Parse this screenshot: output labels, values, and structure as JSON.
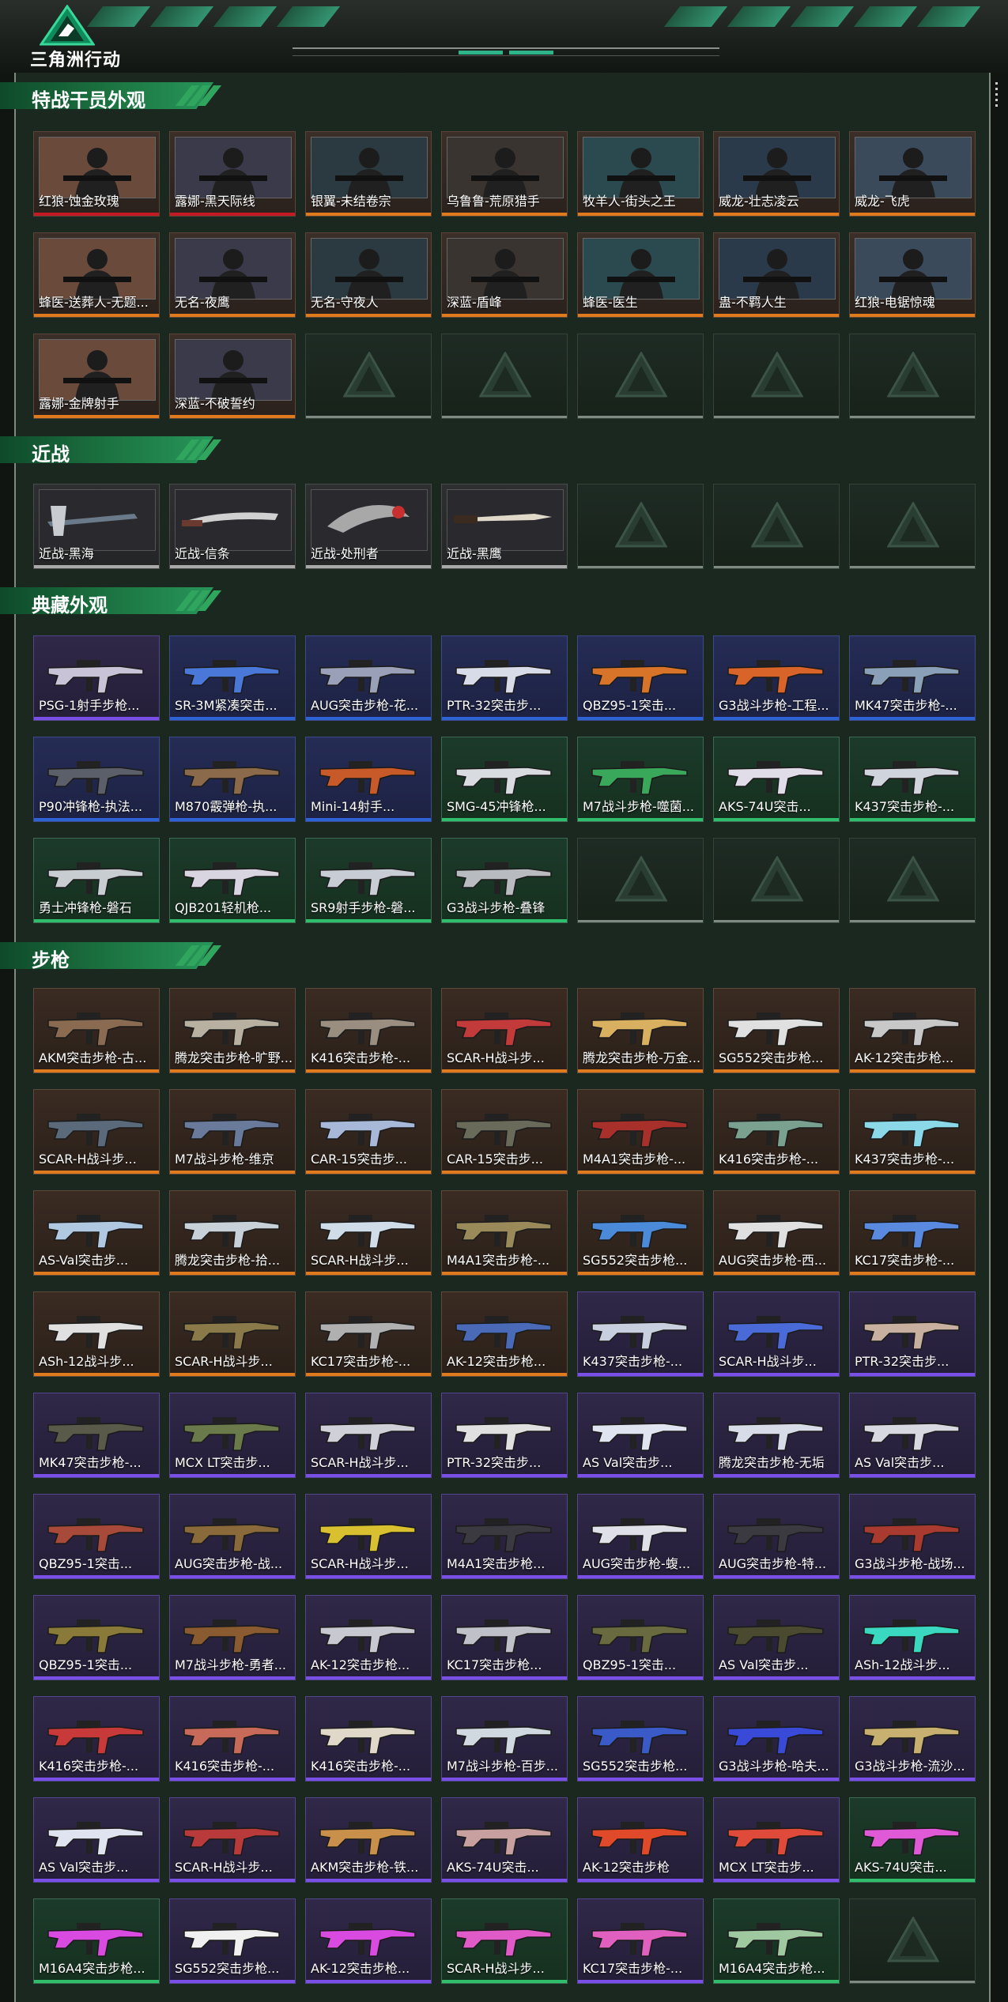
{
  "brand": {
    "name": "三角洲行动"
  },
  "sections": {
    "operators": "特战干员外观",
    "melee": "近战",
    "collection": "典藏外观",
    "rifles": "步枪"
  },
  "operators": [
    {
      "name": "红狼-蚀金玫瑰",
      "rarity": "red"
    },
    {
      "name": "露娜-黑天际线",
      "rarity": "red"
    },
    {
      "name": "银翼-未结卷宗",
      "rarity": "gold"
    },
    {
      "name": "乌鲁鲁-荒原猎手",
      "rarity": "gold"
    },
    {
      "name": "牧羊人-街头之王",
      "rarity": "gold"
    },
    {
      "name": "威龙-壮志凌云",
      "rarity": "gold"
    },
    {
      "name": "威龙-飞虎",
      "rarity": "gold"
    },
    {
      "name": "蜂医-送葬人-无题...",
      "rarity": "gold"
    },
    {
      "name": "无名-夜鹰",
      "rarity": "gold"
    },
    {
      "name": "无名-守夜人",
      "rarity": "gold"
    },
    {
      "name": "深蓝-盾峰",
      "rarity": "gold"
    },
    {
      "name": "蜂医-医生",
      "rarity": "gold"
    },
    {
      "name": "蛊-不羁人生",
      "rarity": "gold"
    },
    {
      "name": "红狼-电锯惊魂",
      "rarity": "gold"
    },
    {
      "name": "露娜-金牌射手",
      "rarity": "gold"
    },
    {
      "name": "深蓝-不破誓约",
      "rarity": "gold"
    }
  ],
  "melee": [
    {
      "name": "近战-黑海"
    },
    {
      "name": "近战-信条"
    },
    {
      "name": "近战-处刑者"
    },
    {
      "name": "近战-黑鹰"
    }
  ],
  "collection": [
    {
      "name": "PSG-1射手步枪...",
      "rarity": "pur",
      "color": "#c9c3d8"
    },
    {
      "name": "SR-3M紧凑突击...",
      "rarity": "blu",
      "color": "#4a78d8"
    },
    {
      "name": "AUG突击步枪-花...",
      "rarity": "blu",
      "color": "#9aa0b8"
    },
    {
      "name": "PTR-32突击步...",
      "rarity": "blu",
      "color": "#d8dce8"
    },
    {
      "name": "QBZ95-1突击...",
      "rarity": "blu",
      "color": "#d8742a"
    },
    {
      "name": "G3战斗步枪-工程...",
      "rarity": "blu",
      "color": "#d8642a"
    },
    {
      "name": "MK47突击步枪-...",
      "rarity": "blu",
      "color": "#8aa0b8"
    },
    {
      "name": "P90冲锋枪-执法...",
      "rarity": "blu",
      "color": "#5a5f6a"
    },
    {
      "name": "M870霰弹枪-执...",
      "rarity": "blu",
      "color": "#8a6a4a"
    },
    {
      "name": "Mini-14射手...",
      "rarity": "blu",
      "color": "#c85a2a"
    },
    {
      "name": "SMG-45冲锋枪...",
      "rarity": "grn",
      "color": "#d8dce0"
    },
    {
      "name": "M7战斗步枪-噬菌...",
      "rarity": "grn",
      "color": "#3aa85a"
    },
    {
      "name": "AKS-74U突击...",
      "rarity": "grn",
      "color": "#e0dce8"
    },
    {
      "name": "K437突击步枪-...",
      "rarity": "grn",
      "color": "#d0d4dc"
    },
    {
      "name": "勇士冲锋枪-磐石",
      "rarity": "grn",
      "color": "#c8cdd2"
    },
    {
      "name": "QJB201轻机枪...",
      "rarity": "grn",
      "color": "#d8d4e0"
    },
    {
      "name": "SR9射手步枪-磐...",
      "rarity": "grn",
      "color": "#c8ccd4"
    },
    {
      "name": "G3战斗步枪-叠锋",
      "rarity": "grn",
      "color": "#b8bcc0"
    }
  ],
  "rifles": [
    {
      "name": "AKM突击步枪-古...",
      "rarity": "org",
      "color": "#8a6a50"
    },
    {
      "name": "腾龙突击步枪-旷野...",
      "rarity": "org",
      "color": "#b8b0a0"
    },
    {
      "name": "K416突击步枪-...",
      "rarity": "org",
      "color": "#9a8e80"
    },
    {
      "name": "SCAR-H战斗步...",
      "rarity": "org",
      "color": "#c23a3a"
    },
    {
      "name": "腾龙突击步枪-万金...",
      "rarity": "org",
      "color": "#d8b060"
    },
    {
      "name": "SG552突击步枪...",
      "rarity": "org",
      "color": "#e0e0e0"
    },
    {
      "name": "AK-12突击步枪...",
      "rarity": "org",
      "color": "#c8c8c8"
    },
    {
      "name": "SCAR-H战斗步...",
      "rarity": "org",
      "color": "#5a6a7a"
    },
    {
      "name": "M7战斗步枪-维京",
      "rarity": "org",
      "color": "#6a7a9a"
    },
    {
      "name": "CAR-15突击步...",
      "rarity": "org",
      "color": "#a8b8d8"
    },
    {
      "name": "CAR-15突击步...",
      "rarity": "org",
      "color": "#6a6a5a"
    },
    {
      "name": "M4A1突击步枪-...",
      "rarity": "org",
      "color": "#a8302a"
    },
    {
      "name": "K416突击步枪-...",
      "rarity": "org",
      "color": "#7aa090"
    },
    {
      "name": "K437突击步枪-...",
      "rarity": "org",
      "color": "#8ad8e8"
    },
    {
      "name": "AS-Val突击步...",
      "rarity": "org",
      "color": "#b0c8e0"
    },
    {
      "name": "腾龙突击步枪-拾...",
      "rarity": "org",
      "color": "#c8d0d8"
    },
    {
      "name": "SCAR-H战斗步...",
      "rarity": "org",
      "color": "#d0dce8"
    },
    {
      "name": "M4A1突击步枪-...",
      "rarity": "org",
      "color": "#9a8a5a"
    },
    {
      "name": "SG552突击步枪...",
      "rarity": "org",
      "color": "#4a8ad8"
    },
    {
      "name": "AUG突击步枪-西...",
      "rarity": "org",
      "color": "#e0e0e0"
    },
    {
      "name": "KC17突击步枪-...",
      "rarity": "org",
      "color": "#5a8ae0"
    },
    {
      "name": "ASh-12战斗步...",
      "rarity": "org",
      "color": "#e0e0e0"
    },
    {
      "name": "SCAR-H战斗步...",
      "rarity": "org",
      "color": "#8a7a4a"
    },
    {
      "name": "KC17突击步枪-...",
      "rarity": "org",
      "color": "#b0b0b0"
    },
    {
      "name": "AK-12突击步枪...",
      "rarity": "org",
      "color": "#4a6ab8"
    },
    {
      "name": "K437突击步枪-...",
      "rarity": "pur",
      "color": "#c8d0e0"
    },
    {
      "name": "SCAR-H战斗步...",
      "rarity": "pur",
      "color": "#4a6ad8"
    },
    {
      "name": "PTR-32突击步...",
      "rarity": "pur",
      "color": "#c8b0a0"
    },
    {
      "name": "MK47突击步枪-...",
      "rarity": "pur",
      "color": "#5a5a4a"
    },
    {
      "name": "MCX LT突击步...",
      "rarity": "pur",
      "color": "#6a7a4a"
    },
    {
      "name": "SCAR-H战斗步...",
      "rarity": "pur",
      "color": "#d0d0d8"
    },
    {
      "name": "PTR-32突击步...",
      "rarity": "pur",
      "color": "#e0e0e0"
    },
    {
      "name": "AS Val突击步...",
      "rarity": "pur",
      "color": "#e0e4f0"
    },
    {
      "name": "腾龙突击步枪-无垢",
      "rarity": "pur",
      "color": "#d8dce8"
    },
    {
      "name": "AS Val突击步...",
      "rarity": "pur",
      "color": "#d8d8e0"
    },
    {
      "name": "QBZ95-1突击...",
      "rarity": "pur",
      "color": "#a84a3a"
    },
    {
      "name": "AUG突击步枪-战...",
      "rarity": "pur",
      "color": "#8a6a3a"
    },
    {
      "name": "SCAR-H战斗步...",
      "rarity": "pur",
      "color": "#d8c030"
    },
    {
      "name": "M4A1突击步枪...",
      "rarity": "pur",
      "color": "#3a3a40"
    },
    {
      "name": "AUG突击步枪-蝮...",
      "rarity": "pur",
      "color": "#e0e0e8"
    },
    {
      "name": "AUG突击步枪-特...",
      "rarity": "pur",
      "color": "#3a3a40"
    },
    {
      "name": "G3战斗步枪-战场...",
      "rarity": "pur",
      "color": "#a83a30"
    },
    {
      "name": "QBZ95-1突击...",
      "rarity": "pur",
      "color": "#8a7a3a"
    },
    {
      "name": "M7战斗步枪-勇者...",
      "rarity": "pur",
      "color": "#8a5a30"
    },
    {
      "name": "AK-12突击步枪...",
      "rarity": "pur",
      "color": "#c8c8d0"
    },
    {
      "name": "KC17突击步枪...",
      "rarity": "pur",
      "color": "#c0c0c8"
    },
    {
      "name": "QBZ95-1突击...",
      "rarity": "pur",
      "color": "#6a6a40"
    },
    {
      "name": "AS Val突击步...",
      "rarity": "pur",
      "color": "#4a4a30"
    },
    {
      "name": "ASh-12战斗步...",
      "rarity": "pur",
      "color": "#3ad8c0"
    },
    {
      "name": "K416突击步枪-...",
      "rarity": "pur",
      "color": "#c83a3a"
    },
    {
      "name": "K416突击步枪-...",
      "rarity": "pur",
      "color": "#c86a5a"
    },
    {
      "name": "K416突击步枪-...",
      "rarity": "pur",
      "color": "#e0d8c8"
    },
    {
      "name": "M7战斗步枪-百步...",
      "rarity": "pur",
      "color": "#d0d8e0"
    },
    {
      "name": "SG552突击步枪...",
      "rarity": "pur",
      "color": "#3a5ac8"
    },
    {
      "name": "G3战斗步枪-哈夫...",
      "rarity": "pur",
      "color": "#3a4ad8"
    },
    {
      "name": "G3战斗步枪-流沙...",
      "rarity": "pur",
      "color": "#c8b070"
    },
    {
      "name": "AS Val突击步...",
      "rarity": "pur",
      "color": "#e0e4f0"
    },
    {
      "name": "SCAR-H战斗步...",
      "rarity": "pur",
      "color": "#b83a3a"
    },
    {
      "name": "AKM突击步枪-铁...",
      "rarity": "pur",
      "color": "#c8904a"
    },
    {
      "name": "AKS-74U突击...",
      "rarity": "pur",
      "color": "#c8a0a0"
    },
    {
      "name": "AK-12突击步枪",
      "rarity": "pur",
      "color": "#e04a2a"
    },
    {
      "name": "MCX LT突击步...",
      "rarity": "pur",
      "color": "#e04a3a"
    },
    {
      "name": "AKS-74U突击...",
      "rarity": "grn",
      "color": "#e05ad8"
    },
    {
      "name": "M16A4突击步枪...",
      "rarity": "grn",
      "color": "#d84ae0"
    },
    {
      "name": "SG552突击步枪...",
      "rarity": "pur",
      "color": "#f0f0f0"
    },
    {
      "name": "AK-12突击步枪...",
      "rarity": "pur",
      "color": "#d84ae0"
    },
    {
      "name": "SCAR-H战斗步...",
      "rarity": "grn",
      "color": "#e05ac8"
    },
    {
      "name": "KC17突击步枪-...",
      "rarity": "pur",
      "color": "#e060c0"
    },
    {
      "name": "M16A4突击步枪...",
      "rarity": "grn",
      "color": "#a0c8a0"
    }
  ]
}
